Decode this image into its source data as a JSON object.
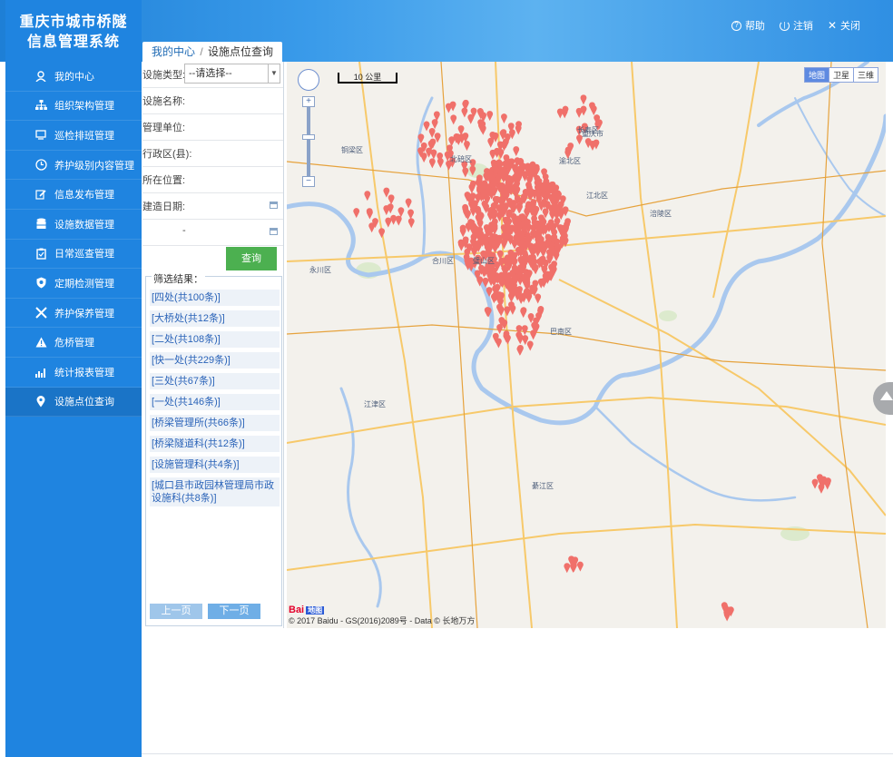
{
  "app": {
    "title_line1": "重庆市城市桥隧",
    "title_line2": "信息管理系统"
  },
  "header": {
    "actions": [
      {
        "label": "帮助",
        "icon": "help-icon"
      },
      {
        "label": "注销",
        "icon": "power-icon"
      },
      {
        "label": "关闭",
        "icon": "close-icon"
      }
    ]
  },
  "breadcrumb": {
    "home": "我的中心",
    "separator": "/",
    "current": "设施点位查询"
  },
  "sidebar": {
    "items": [
      {
        "label": "我的中心",
        "icon": "user-icon"
      },
      {
        "label": "组织架构管理",
        "icon": "org-chart-icon"
      },
      {
        "label": "巡检排班管理",
        "icon": "monitor-icon"
      },
      {
        "label": "养护级别内容管理",
        "icon": "clock-icon"
      },
      {
        "label": "信息发布管理",
        "icon": "edit-icon"
      },
      {
        "label": "设施数据管理",
        "icon": "database-icon"
      },
      {
        "label": "日常巡查管理",
        "icon": "clipboard-icon"
      },
      {
        "label": "定期检测管理",
        "icon": "shield-icon"
      },
      {
        "label": "养护保养管理",
        "icon": "tools-icon"
      },
      {
        "label": "危桥管理",
        "icon": "warning-icon"
      },
      {
        "label": "统计报表管理",
        "icon": "bar-chart-icon"
      },
      {
        "label": "设施点位查询",
        "icon": "location-pin-icon"
      }
    ]
  },
  "filter": {
    "facility_type_label": "设施类型:",
    "facility_type_value": "--请选择--",
    "facility_name_label": "设施名称:",
    "management_unit_label": "管理单位:",
    "district_label": "行政区(县):",
    "location_label": "所在位置:",
    "build_date_label": "建造日期:",
    "date_range_separator": "-",
    "search_button": "查询"
  },
  "results": {
    "legend": "筛选结果：",
    "items": [
      "[四处(共100条)]",
      "[大桥处(共12条)]",
      "[二处(共108条)]",
      "[快一处(共229条)]",
      "[三处(共67条)]",
      "[一处(共146条)]",
      "[桥梁管理所(共66条)]",
      "[桥梁隧道科(共12条)]",
      "[设施管理科(共4条)]",
      "[城口县市政园林管理局市政设施科(共8条)]"
    ],
    "prev_page": "上一页",
    "next_page": "下一页"
  },
  "map": {
    "type_buttons": [
      "地图",
      "卫星",
      "三维"
    ],
    "scale_label": "10 公里",
    "copyright": "© 2017 Baidu - GS(2016)2089号 - Data © 长地万方",
    "logo": "Bai",
    "logo_badge": "地图",
    "place_labels": [
      "重庆市",
      "江津区",
      "合川区",
      "长寿区",
      "涪陵区",
      "綦江区",
      "璧山区",
      "铜梁区",
      "永川区",
      "北碚区",
      "渝北区",
      "巴南区",
      "江北区"
    ],
    "colors": {
      "marker": "#f0706a",
      "water": "#a9c8ee",
      "road": "#f7c96a",
      "highway": "#e6a23c",
      "land": "#f3f1ec",
      "green": "#cfe6bf"
    }
  }
}
